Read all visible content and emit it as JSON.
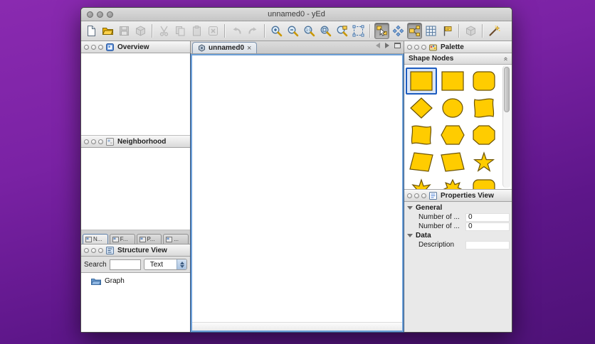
{
  "window": {
    "title": "unnamed0 - yEd",
    "traffic_lights": [
      "close",
      "minimize",
      "zoom"
    ]
  },
  "toolbar": {
    "buttons": [
      {
        "name": "new-document",
        "state": "normal"
      },
      {
        "name": "open-file",
        "state": "normal"
      },
      {
        "name": "save",
        "state": "disabled"
      },
      {
        "name": "export-3d",
        "state": "disabled"
      },
      {
        "name": "separator"
      },
      {
        "name": "cut",
        "state": "disabled"
      },
      {
        "name": "copy",
        "state": "disabled"
      },
      {
        "name": "paste",
        "state": "disabled"
      },
      {
        "name": "delete",
        "state": "disabled"
      },
      {
        "name": "separator"
      },
      {
        "name": "undo",
        "state": "disabled"
      },
      {
        "name": "redo",
        "state": "disabled"
      },
      {
        "name": "separator"
      },
      {
        "name": "zoom-in",
        "state": "normal"
      },
      {
        "name": "zoom-out",
        "state": "normal"
      },
      {
        "name": "zoom-original",
        "state": "normal"
      },
      {
        "name": "fit-content",
        "state": "normal"
      },
      {
        "name": "zoom-to-selection",
        "state": "normal"
      },
      {
        "name": "select-area",
        "state": "normal"
      },
      {
        "name": "separator"
      },
      {
        "name": "edit-mode",
        "state": "pressed"
      },
      {
        "name": "layout-mode",
        "state": "normal"
      },
      {
        "name": "local-view",
        "state": "pressed"
      },
      {
        "name": "grid",
        "state": "normal"
      },
      {
        "name": "flag",
        "state": "normal"
      },
      {
        "name": "separator"
      },
      {
        "name": "view-3d",
        "state": "disabled"
      },
      {
        "name": "separator"
      },
      {
        "name": "wizard",
        "state": "normal"
      }
    ]
  },
  "document_tab": {
    "label": "unnamed0",
    "close_glyph": "×"
  },
  "panels": {
    "overview": {
      "title": "Overview"
    },
    "neighborhood": {
      "title": "Neighborhood"
    },
    "dock_tabs": [
      {
        "label": "N..."
      },
      {
        "label": "F..."
      },
      {
        "label": "P..."
      },
      {
        "label": "..."
      }
    ],
    "structure": {
      "title": "Structure View",
      "search_label": "Search",
      "search_value": "",
      "filter_selected": "Text",
      "tree": [
        {
          "label": "Graph",
          "icon": "folder-icon"
        }
      ]
    },
    "palette": {
      "title": "Palette",
      "section_title": "Shape Nodes",
      "collapse_glyph": "«",
      "selected_index": 0,
      "shapes": [
        "square",
        "square-2",
        "round-rectangle",
        "diamond",
        "ellipse",
        "wave-rectangle",
        "wave-rectangle-2",
        "hexagon",
        "octagon",
        "parallelogram",
        "trapezoid",
        "star-5",
        "star-6",
        "star-8",
        "round-rectangle-2"
      ]
    },
    "properties": {
      "title": "Properties View",
      "groups": [
        {
          "label": "General",
          "rows": [
            {
              "label": "Number of ...",
              "value": "0"
            },
            {
              "label": "Number of ...",
              "value": "0"
            }
          ]
        },
        {
          "label": "Data",
          "rows": [
            {
              "label": "Description",
              "value": ""
            }
          ]
        }
      ]
    }
  },
  "colors": {
    "shape_fill": "#ffcc00",
    "shape_stroke": "#6b5200",
    "selection_blue": "#1c5bbf",
    "background_top": "#8a2ab0",
    "background_bottom": "#4e1277"
  }
}
